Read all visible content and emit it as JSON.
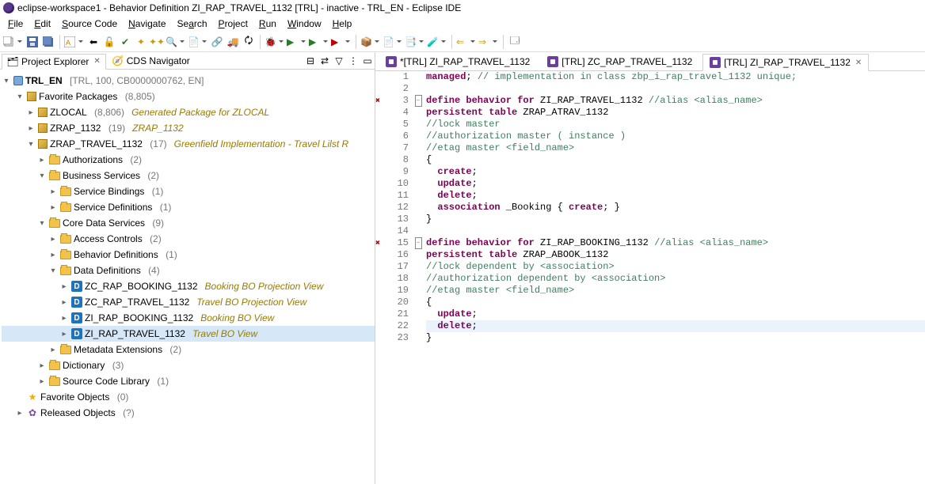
{
  "window": {
    "title": "eclipse-workspace1 - Behavior Definition ZI_RAP_TRAVEL_1132 [TRL]  - inactive - TRL_EN - Eclipse IDE"
  },
  "menu": {
    "file": "File",
    "edit": "Edit",
    "source": "Source Code",
    "navigate": "Navigate",
    "search": "Search",
    "project": "Project",
    "run": "Run",
    "window": "Window",
    "help": "Help"
  },
  "views": {
    "project_explorer": "Project Explorer",
    "cds_navigator": "CDS Navigator"
  },
  "tree": {
    "root": {
      "label": "TRL_EN",
      "suffix": "[TRL, 100, CB0000000762, EN]"
    },
    "fav_pkg": {
      "label": "Favorite Packages",
      "count": "(8,805)"
    },
    "zlocal": {
      "label": "ZLOCAL",
      "count": "(8,806)",
      "desc": "Generated Package for ZLOCAL"
    },
    "zrap": {
      "label": "ZRAP_1132",
      "count": "(19)",
      "desc": "ZRAP_1132"
    },
    "ztravel": {
      "label": "ZRAP_TRAVEL_1132",
      "count": "(17)",
      "desc": "Greenfield Implementation - Travel Lilst R"
    },
    "auth": {
      "label": "Authorizations",
      "count": "(2)"
    },
    "bsvc": {
      "label": "Business Services",
      "count": "(2)"
    },
    "sbind": {
      "label": "Service Bindings",
      "count": "(1)"
    },
    "sdef": {
      "label": "Service Definitions",
      "count": "(1)"
    },
    "cds": {
      "label": "Core Data Services",
      "count": "(9)"
    },
    "acc": {
      "label": "Access Controls",
      "count": "(2)"
    },
    "bdef": {
      "label": "Behavior Definitions",
      "count": "(1)"
    },
    "ddef": {
      "label": "Data Definitions",
      "count": "(4)"
    },
    "dd1": {
      "label": "ZC_RAP_BOOKING_1132",
      "desc": "Booking BO Projection View"
    },
    "dd2": {
      "label": "ZC_RAP_TRAVEL_1132",
      "desc": "Travel BO Projection View"
    },
    "dd3": {
      "label": "ZI_RAP_BOOKING_1132",
      "desc": "Booking BO View"
    },
    "dd4": {
      "label": "ZI_RAP_TRAVEL_1132",
      "desc": "Travel BO View"
    },
    "mext": {
      "label": "Metadata Extensions",
      "count": "(2)"
    },
    "dict": {
      "label": "Dictionary",
      "count": "(3)"
    },
    "srclib": {
      "label": "Source Code Library",
      "count": "(1)"
    },
    "favobj": {
      "label": "Favorite Objects",
      "count": "(0)"
    },
    "relobj": {
      "label": "Released Objects",
      "count": "(?)"
    }
  },
  "editor_tabs": {
    "t1": "*[TRL] ZI_RAP_TRAVEL_1132",
    "t2": "[TRL] ZC_RAP_TRAVEL_1132",
    "t3": "[TRL] ZI_RAP_TRAVEL_1132"
  },
  "code_lines": [
    {
      "n": "1",
      "marker": "",
      "fold": "",
      "html": "<span class='kw'>managed</span>; <span class='cm'>// implementation in class zbp_i_rap_travel_1132 unique;</span>"
    },
    {
      "n": "2",
      "marker": "",
      "fold": "",
      "html": " "
    },
    {
      "n": "3",
      "marker": "err",
      "fold": "minus",
      "html": "<span class='kw'>define behavior for</span> <span class='id'>ZI_RAP_TRAVEL_1132</span> <span class='cm'>//alias &lt;alias_name&gt;</span>"
    },
    {
      "n": "4",
      "marker": "",
      "fold": "",
      "html": "<span class='kw'>persistent table</span> ZRAP_ATRAV_1132"
    },
    {
      "n": "5",
      "marker": "",
      "fold": "",
      "html": "<span class='cm'>//lock master</span>"
    },
    {
      "n": "6",
      "marker": "",
      "fold": "",
      "html": "<span class='cm'>//authorization master ( instance )</span>"
    },
    {
      "n": "7",
      "marker": "",
      "fold": "",
      "html": "<span class='cm'>//etag master &lt;field_name&gt;</span>"
    },
    {
      "n": "8",
      "marker": "",
      "fold": "",
      "html": "{"
    },
    {
      "n": "9",
      "marker": "",
      "fold": "",
      "html": "  <span class='kw'>create</span>;"
    },
    {
      "n": "10",
      "marker": "",
      "fold": "",
      "html": "  <span class='kw'>update</span>;"
    },
    {
      "n": "11",
      "marker": "",
      "fold": "",
      "html": "  <span class='kw'>delete</span>;"
    },
    {
      "n": "12",
      "marker": "",
      "fold": "",
      "html": "  <span class='kw'>association</span> _Booking { <span class='kw'>create</span>; }"
    },
    {
      "n": "13",
      "marker": "",
      "fold": "",
      "html": "}"
    },
    {
      "n": "14",
      "marker": "",
      "fold": "",
      "html": " "
    },
    {
      "n": "15",
      "marker": "err",
      "fold": "minus",
      "html": "<span class='kw'>define behavior for</span> <span class='id'>ZI_RAP_BOOKING_1132</span> <span class='cm'>//alias &lt;alias_name&gt;</span>"
    },
    {
      "n": "16",
      "marker": "",
      "fold": "",
      "html": "<span class='kw'>persistent table</span> ZRAP_ABOOK_1132"
    },
    {
      "n": "17",
      "marker": "",
      "fold": "",
      "html": "<span class='cm'>//lock dependent by &lt;association&gt;</span>"
    },
    {
      "n": "18",
      "marker": "",
      "fold": "",
      "html": "<span class='cm'>//authorization dependent by &lt;association&gt;</span>"
    },
    {
      "n": "19",
      "marker": "",
      "fold": "",
      "html": "<span class='cm'>//etag master &lt;field_name&gt;</span>"
    },
    {
      "n": "20",
      "marker": "",
      "fold": "",
      "html": "{"
    },
    {
      "n": "21",
      "marker": "",
      "fold": "",
      "html": "  <span class='kw'>update</span>;"
    },
    {
      "n": "22",
      "marker": "",
      "fold": "",
      "html": "  <span class='kw'>delete</span>;",
      "hl": true
    },
    {
      "n": "23",
      "marker": "",
      "fold": "",
      "html": "}"
    }
  ]
}
